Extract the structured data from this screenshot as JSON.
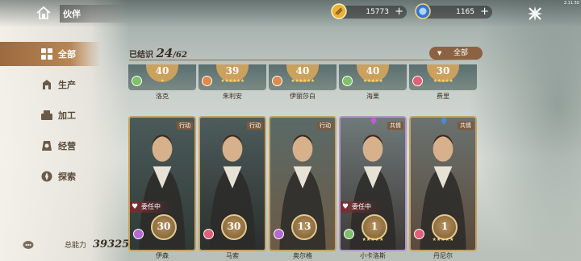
{
  "header": {
    "title": "伙伴",
    "version": "2.11.50",
    "resources": [
      {
        "icon": "gold-coin-icon",
        "value": "15773"
      },
      {
        "icon": "blue-gem-icon",
        "value": "1165"
      }
    ]
  },
  "sidebar": {
    "items": [
      {
        "label": "全部",
        "icon": "all-icon",
        "active": true
      },
      {
        "label": "生产",
        "icon": "production-icon",
        "active": false
      },
      {
        "label": "加工",
        "icon": "processing-icon",
        "active": false
      },
      {
        "label": "经营",
        "icon": "business-icon",
        "active": false
      },
      {
        "label": "探索",
        "icon": "explore-icon",
        "active": false
      }
    ],
    "power_label": "总能力",
    "power_value": "39325"
  },
  "list": {
    "owned_label": "已结识",
    "owned_count": "24",
    "owned_total": "/62",
    "filter_label": "全部"
  },
  "top_row": [
    {
      "name": "洛克",
      "level": "40",
      "stars": "✦",
      "badge_color": "#7fc06a"
    },
    {
      "name": "朱利安",
      "level": "39",
      "stars": "★★★★★★",
      "badge_color": "#e08a4a"
    },
    {
      "name": "伊丽莎白",
      "level": "40",
      "stars": "★★★★★★",
      "badge_color": "#e08a4a"
    },
    {
      "name": "海栗",
      "level": "40",
      "stars": "★★★★★",
      "badge_color": "#7fc06a"
    },
    {
      "name": "费里",
      "level": "30",
      "stars": "★★★★★",
      "badge_color": "#e0607a"
    }
  ],
  "cards": [
    {
      "name": "伊森",
      "level": "30",
      "tag": "行动",
      "stars": "",
      "assign": "委任中",
      "badge_color": "#b46ad0",
      "frame": "gold",
      "bg1": "#4b5a5a",
      "bg2": "#2f3a36",
      "gem": ""
    },
    {
      "name": "马索",
      "level": "30",
      "tag": "行动",
      "stars": "",
      "assign": "",
      "badge_color": "#e0607a",
      "frame": "gold",
      "bg1": "#4d5c5c",
      "bg2": "#2a2f2c",
      "gem": ""
    },
    {
      "name": "奥尔格",
      "level": "13",
      "tag": "行动",
      "stars": "",
      "assign": "",
      "badge_color": "#b46ad0",
      "frame": "gold",
      "bg1": "#5a6a68",
      "bg2": "#6d5a44",
      "gem": ""
    },
    {
      "name": "小卡洛斯",
      "level": "1",
      "tag": "共情",
      "stars": "★★★★★",
      "assign": "委任中",
      "badge_color": "#7fc06a",
      "frame": "purple",
      "bg1": "#6f7a7a",
      "bg2": "#3d3a36",
      "gem": "#c45ad8"
    },
    {
      "name": "丹尼尔",
      "level": "1",
      "tag": "共情",
      "stars": "★★★★★",
      "assign": "",
      "badge_color": "#e0607a",
      "frame": "gold",
      "bg1": "#6a7270",
      "bg2": "#5a4a3a",
      "gem": "#4a8ad8"
    }
  ]
}
